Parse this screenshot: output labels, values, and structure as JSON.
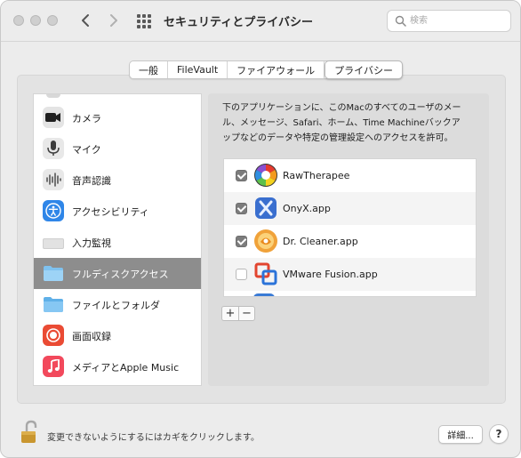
{
  "window": {
    "title": "セキュリティとプライバシー",
    "search_placeholder": "検索"
  },
  "tabs": [
    {
      "label": "一般",
      "active": false
    },
    {
      "label": "FileVault",
      "active": false
    },
    {
      "label": "ファイアウォール",
      "active": false
    },
    {
      "label": "プライバシー",
      "active": true
    }
  ],
  "sidebar": {
    "items": [
      {
        "label": "カメラ",
        "icon": "camera-icon"
      },
      {
        "label": "マイク",
        "icon": "microphone-icon"
      },
      {
        "label": "音声認識",
        "icon": "speech-recognition-icon"
      },
      {
        "label": "アクセシビリティ",
        "icon": "accessibility-icon"
      },
      {
        "label": "入力監視",
        "icon": "keyboard-icon"
      },
      {
        "label": "フルディスクアクセス",
        "icon": "folder-icon",
        "selected": true
      },
      {
        "label": "ファイルとフォルダ",
        "icon": "folder-icon"
      },
      {
        "label": "画面収録",
        "icon": "screen-recording-icon"
      },
      {
        "label": "メディアとApple Music",
        "icon": "music-icon"
      }
    ]
  },
  "main": {
    "description_lines": [
      "下のアプリケーションに、このMacのすべてのユーザのメー",
      "ル、メッセージ、Safari、ホーム、Time Machineバックア",
      "ップなどのデータや特定の管理設定へのアクセスを許可。"
    ],
    "apps": [
      {
        "name": "RawTherapee",
        "checked": true,
        "icon": "rawtherapee-icon"
      },
      {
        "name": "OnyX.app",
        "checked": true,
        "icon": "onyx-icon"
      },
      {
        "name": "Dr. Cleaner.app",
        "checked": true,
        "icon": "dr-cleaner-icon"
      },
      {
        "name": "VMware Fusion.app",
        "checked": false,
        "icon": "vmware-fusion-icon"
      }
    ],
    "add_label": "+",
    "remove_label": "−"
  },
  "footer": {
    "lock_text": "変更できないようにするにはカギをクリックします。",
    "advanced_label": "詳細...",
    "help_label": "?"
  },
  "colors": {
    "selected_row": "#8d8d8d",
    "accent_blue": "#2f86e8",
    "checkbox_on": "#7c7c7c"
  }
}
